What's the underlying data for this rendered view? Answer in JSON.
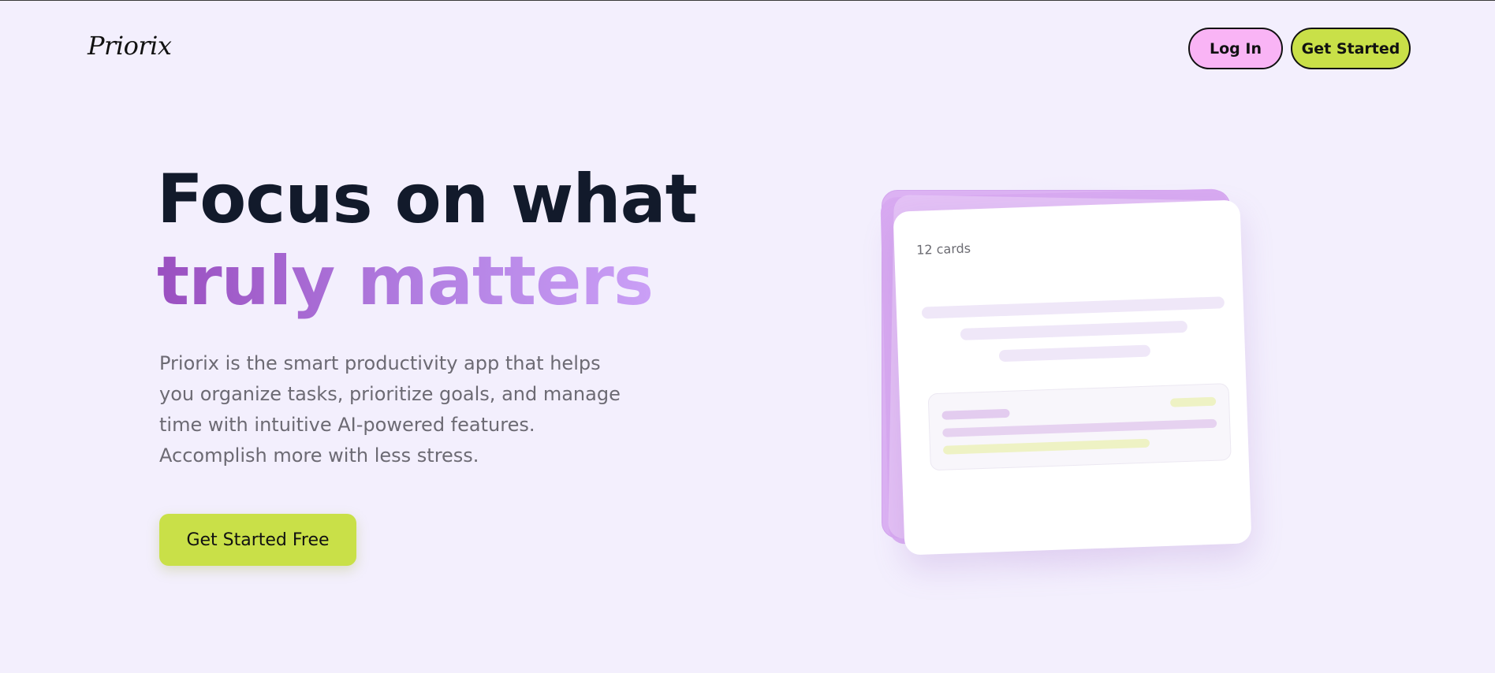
{
  "header": {
    "logo": "Priorix",
    "login_label": "Log In",
    "get_started_label": "Get Started"
  },
  "hero": {
    "headline_line1": "Focus on what",
    "headline_line2": "truly matters",
    "description": "Priorix is the smart productivity app that helps you organize tasks, prioritize goals, and manage time with intuitive AI-powered features. Accomplish more with less stress.",
    "cta_label": "Get Started Free"
  },
  "illustration": {
    "card_count": "12 cards"
  },
  "colors": {
    "background": "#f3effd",
    "accent_lime": "#c9e048",
    "accent_pink": "#f9b4f5",
    "headline_dark": "#121a2b",
    "gradient_start": "#9a4fc0",
    "gradient_end": "#cfa6fa"
  }
}
